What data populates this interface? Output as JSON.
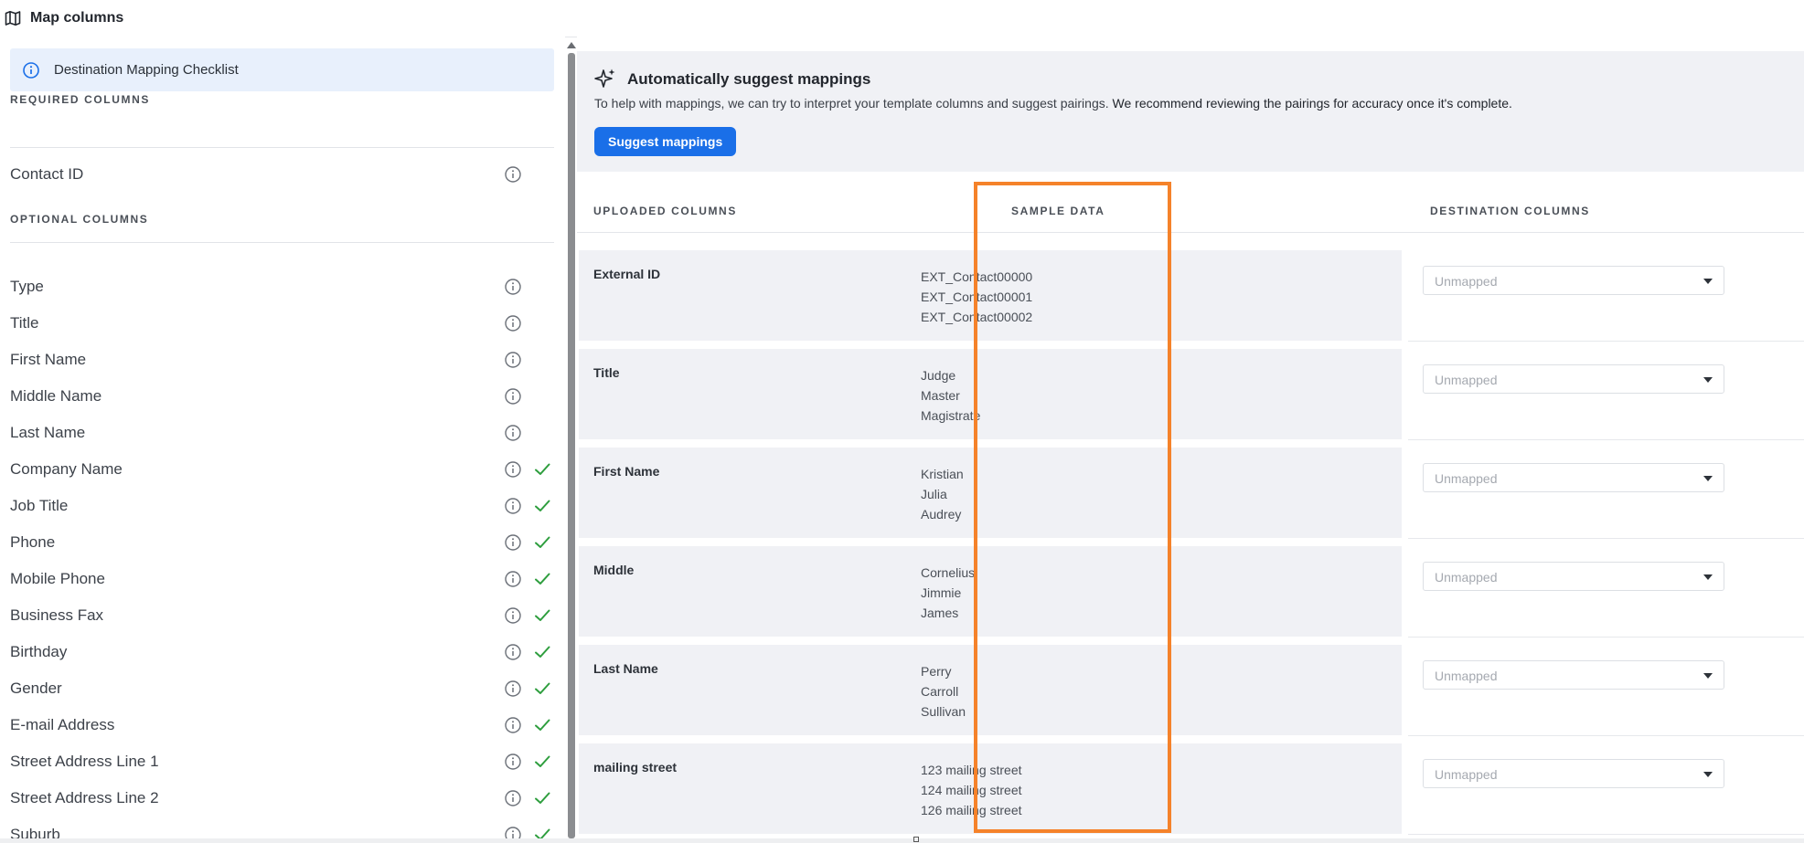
{
  "header": {
    "title": "Map columns",
    "icon": "map-icon"
  },
  "left": {
    "checklist_label": "Destination Mapping Checklist",
    "required_heading": "REQUIRED COLUMNS",
    "required": [
      {
        "label": "Contact ID",
        "checked": false
      }
    ],
    "optional_heading": "OPTIONAL COLUMNS",
    "optional": [
      {
        "label": "Type",
        "checked": false
      },
      {
        "label": "Title",
        "checked": false
      },
      {
        "label": "First Name",
        "checked": false
      },
      {
        "label": "Middle Name",
        "checked": false
      },
      {
        "label": "Last Name",
        "checked": false
      },
      {
        "label": "Company Name",
        "checked": true
      },
      {
        "label": "Job Title",
        "checked": true
      },
      {
        "label": "Phone",
        "checked": true
      },
      {
        "label": "Mobile Phone",
        "checked": true
      },
      {
        "label": "Business Fax",
        "checked": true
      },
      {
        "label": "Birthday",
        "checked": true
      },
      {
        "label": "Gender",
        "checked": true
      },
      {
        "label": "E-mail Address",
        "checked": true
      },
      {
        "label": "Street Address Line 1",
        "checked": true
      },
      {
        "label": "Street Address Line 2",
        "checked": true
      },
      {
        "label": "Suburb",
        "checked": true
      }
    ]
  },
  "suggest": {
    "title": "Automatically suggest mappings",
    "description": "To help with mappings, we can try to interpret your template columns and suggest pairings.",
    "description_bold": "We recommend reviewing the pairings for accuracy once it's complete.",
    "button_label": "Suggest mappings"
  },
  "table": {
    "headers": {
      "uploaded": "UPLOADED COLUMNS",
      "sample": "SAMPLE DATA",
      "destination": "DESTINATION COLUMNS"
    },
    "rows": [
      {
        "source": "External ID",
        "samples": [
          "EXT_Contact00000",
          "EXT_Contact00001",
          "EXT_Contact00002"
        ],
        "destination_placeholder": "Unmapped"
      },
      {
        "source": "Title",
        "samples": [
          "Judge",
          "Master",
          "Magistrate"
        ],
        "destination_placeholder": "Unmapped"
      },
      {
        "source": "First Name",
        "samples": [
          "Kristian",
          "Julia",
          "Audrey"
        ],
        "destination_placeholder": "Unmapped"
      },
      {
        "source": "Middle",
        "samples": [
          "Cornelius",
          "Jimmie",
          "James"
        ],
        "destination_placeholder": "Unmapped"
      },
      {
        "source": "Last Name",
        "samples": [
          "Perry",
          "Carroll",
          "Sullivan"
        ],
        "destination_placeholder": "Unmapped"
      },
      {
        "source": "mailing street",
        "samples": [
          "123 mailing street",
          "124 mailing street",
          "126 mailing street"
        ],
        "destination_placeholder": "Unmapped"
      }
    ]
  },
  "colors": {
    "accent": "#1a6fe8",
    "check": "#2e9e3e",
    "highlight": "#f5822a",
    "panel_bg": "#f0f1f5"
  }
}
